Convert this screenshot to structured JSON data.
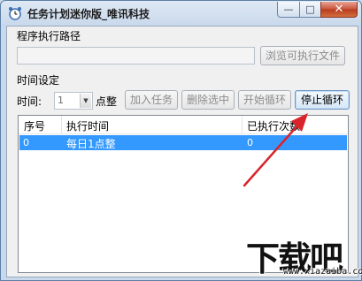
{
  "window": {
    "title": "任务计划迷你版_唯讯科技",
    "controls": {
      "minimize": "—",
      "maximize": "□",
      "close": "✕"
    }
  },
  "path_section": {
    "label": "程序执行路径",
    "path_value": "",
    "browse_button": "浏览可执行文件"
  },
  "time_section": {
    "label": "时间设定",
    "time_label": "时间:",
    "hour_value": "1",
    "unit_label": "点整",
    "buttons": {
      "add_task": "加入任务",
      "delete_selected": "删除选中",
      "start_loop": "开始循环",
      "stop_loop": "停止循环"
    }
  },
  "task_list": {
    "columns": [
      "序号",
      "执行时间",
      "已执行次数"
    ],
    "rows": [
      {
        "index": "0",
        "time": "每日1点整",
        "count": "0"
      }
    ]
  },
  "watermark": {
    "text": "下载吧",
    "url": "www.xiazaiba.com"
  },
  "colors": {
    "selection": "#3399ff",
    "annotation_arrow": "#d9242b",
    "close_button": "#c8533a"
  }
}
